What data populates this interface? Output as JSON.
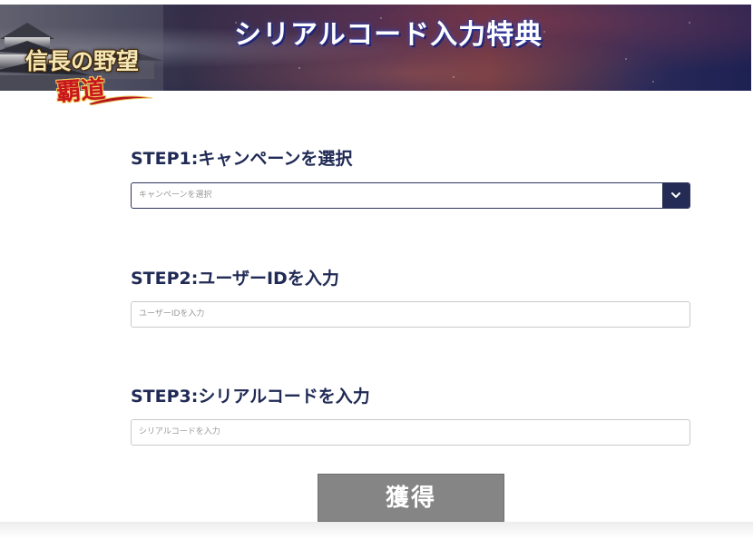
{
  "banner": {
    "title": "シリアルコード入力特典",
    "logo_main": "信長の野望",
    "logo_sub": "覇道"
  },
  "steps": [
    {
      "heading": "STEP1:キャンペーンを選択",
      "placeholder": "キャンペーンを選択",
      "type": "select"
    },
    {
      "heading": "STEP2:ユーザーIDを入力",
      "placeholder": "ユーザーIDを入力",
      "type": "text"
    },
    {
      "heading": "STEP3:シリアルコードを入力",
      "placeholder": "シリアルコードを入力",
      "type": "text"
    }
  ],
  "submit": {
    "label": "獲得"
  },
  "colors": {
    "heading": "#202a55",
    "select_arrow_bg": "#242b55",
    "submit_bg": "#858585"
  },
  "icons": {
    "select_arrow": "chevron-down-icon"
  }
}
